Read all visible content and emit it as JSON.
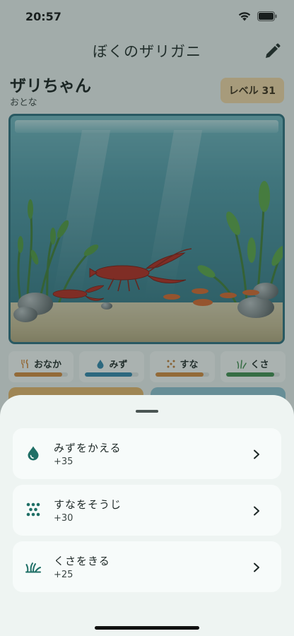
{
  "status_bar": {
    "time": "20:57"
  },
  "nav": {
    "title": "ぼくのザリガニ"
  },
  "pet": {
    "name": "ザリちゃん",
    "stage": "おとな",
    "level": "レベル 31"
  },
  "gauges": [
    {
      "label": "おなか",
      "icon": "fork-knife-icon",
      "level": 0.9,
      "color": "#d68a3a"
    },
    {
      "label": "みず",
      "icon": "water-drop-icon",
      "level": 0.88,
      "color": "#2f86ad"
    },
    {
      "label": "すな",
      "icon": "sand-dots-icon",
      "level": 0.9,
      "color": "#d68a3a"
    },
    {
      "label": "くさ",
      "icon": "grass-icon",
      "level": 0.9,
      "color": "#3f8f4e"
    }
  ],
  "sheet": {
    "actions": [
      {
        "title": "みずをかえる",
        "value": "+35",
        "icon": "water-drop-icon"
      },
      {
        "title": "すなをそうじ",
        "value": "+30",
        "icon": "sand-dots-icon"
      },
      {
        "title": "くさをきる",
        "value": "+25",
        "icon": "grass-icon"
      }
    ]
  },
  "colors": {
    "accent": "#1f6f66",
    "level_badge": "#f6d8a6",
    "sheet_bg": "#eef4f2"
  }
}
